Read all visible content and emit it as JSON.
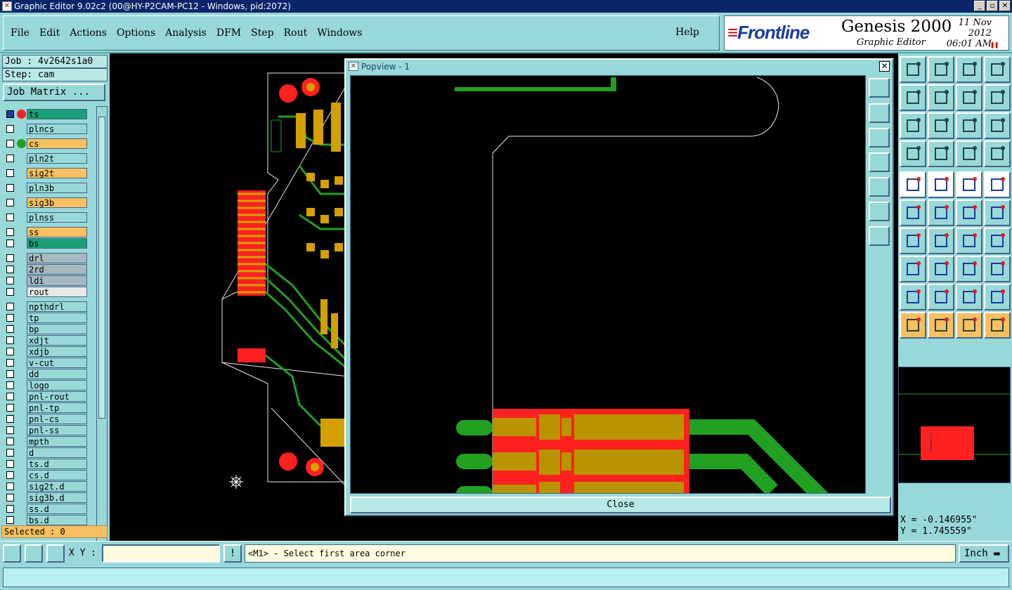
{
  "window": {
    "title": "Graphic Editor 9.02c2 (00@HY-P2CAM-PC12 - Windows, pid:2072)",
    "buttons": [
      "_",
      "▫",
      "✕"
    ]
  },
  "menu": {
    "items": [
      "File",
      "Edit",
      "Actions",
      "Options",
      "Analysis",
      "DFM",
      "Step",
      "Rout",
      "Windows"
    ],
    "help": "Help"
  },
  "brand": {
    "logo": "Frontline",
    "product": "Genesis 2000",
    "subtitle": "Graphic Editor",
    "date": "11 Nov 2012",
    "time": "06:01  AM"
  },
  "job": {
    "job_label": "Job : 4v2642s1a0",
    "step_label": "Step: cam",
    "matrix_button": "Job Matrix ..."
  },
  "layers": [
    {
      "name": "ts",
      "color": "#1aa078",
      "dot": "#ff2020",
      "selected": true
    },
    {
      "name": "plncs",
      "color": "#98d8d8"
    },
    {
      "name": "cs",
      "color": "#f8c060",
      "dot": "#22a022"
    },
    {
      "name": "pln2t",
      "color": "#98d8d8"
    },
    {
      "name": "sig2t",
      "color": "#f8c060"
    },
    {
      "name": "pln3b",
      "color": "#98d8d8"
    },
    {
      "name": "sig3b",
      "color": "#f8c060"
    },
    {
      "name": "plnss",
      "color": "#98d8d8"
    },
    {
      "name": "ss",
      "color": "#f8c060"
    },
    {
      "name": "bs",
      "color": "#1aa078"
    },
    {
      "name": "drl",
      "color": "#a8b8c0"
    },
    {
      "name": "2rd",
      "color": "#a8b8c0"
    },
    {
      "name": "ldi",
      "color": "#a8b8c0"
    },
    {
      "name": "rout",
      "color": "#e8e8e8"
    },
    {
      "name": "npthdrl",
      "color": "#98d8d8"
    },
    {
      "name": "tp",
      "color": "#98d8d8"
    },
    {
      "name": "bp",
      "color": "#98d8d8"
    },
    {
      "name": "xdjt",
      "color": "#98d8d8"
    },
    {
      "name": "xdjb",
      "color": "#98d8d8"
    },
    {
      "name": "v-cut",
      "color": "#98d8d8"
    },
    {
      "name": "dd",
      "color": "#98d8d8"
    },
    {
      "name": "logo",
      "color": "#98d8d8"
    },
    {
      "name": "pnl-rout",
      "color": "#98d8d8"
    },
    {
      "name": "pnl-tp",
      "color": "#98d8d8"
    },
    {
      "name": "pnl-cs",
      "color": "#98d8d8"
    },
    {
      "name": "pnl-ss",
      "color": "#98d8d8"
    },
    {
      "name": "mpth",
      "color": "#98d8d8"
    },
    {
      "name": "d",
      "color": "#98d8d8"
    },
    {
      "name": "ts.d",
      "color": "#98d8d8"
    },
    {
      "name": "cs.d",
      "color": "#98d8d8"
    },
    {
      "name": "sig2t.d",
      "color": "#98d8d8"
    },
    {
      "name": "sig3b.d",
      "color": "#98d8d8"
    },
    {
      "name": "ss.d",
      "color": "#98d8d8"
    },
    {
      "name": "bs.d",
      "color": "#98d8d8"
    }
  ],
  "selected_label": "Selected : 0",
  "popview": {
    "title": "Popview - 1",
    "close_button": "Close"
  },
  "coords": {
    "x": "X = -0.146955\"",
    "y": "Y =  1.745559\""
  },
  "bottom": {
    "xy_label": "X Y :",
    "xy_value": "",
    "message": "<M1> - Select first area corner",
    "units": "Inch"
  }
}
